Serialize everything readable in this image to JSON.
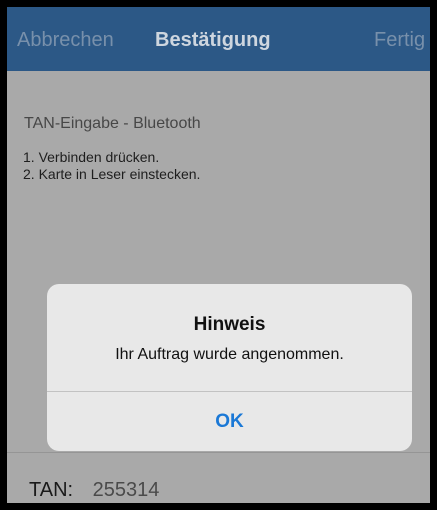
{
  "navbar": {
    "cancel_label": "Abbrechen",
    "title": "Bestätigung",
    "done_label": "Fertig"
  },
  "content": {
    "section_header": "TAN-Eingabe - Bluetooth",
    "steps": [
      "1. Verbinden drücken.",
      "2. Karte in Leser einstecken."
    ]
  },
  "tan": {
    "label": "TAN:",
    "value": "255314"
  },
  "alert": {
    "title": "Hinweis",
    "message": "Ihr Auftrag wurde angenommen.",
    "ok_label": "OK"
  },
  "colors": {
    "navbar": "#2c5886",
    "background_dimmed": "#a9a9a9",
    "alert_button": "#1a78d6"
  }
}
